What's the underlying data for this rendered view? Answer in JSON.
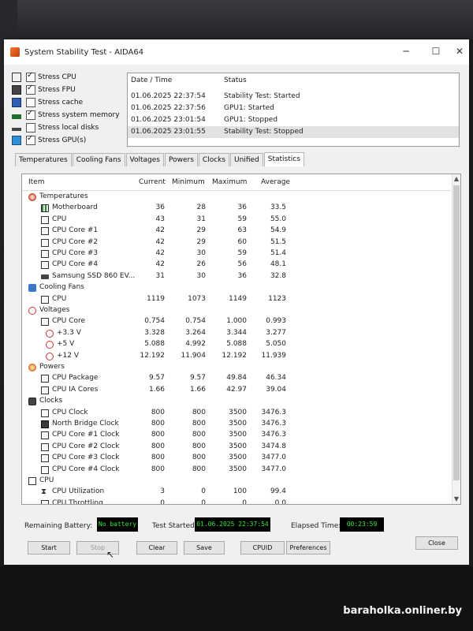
{
  "window": {
    "title": "System Stability Test - AIDA64"
  },
  "stress_options": [
    {
      "label": "Stress CPU",
      "checked": true,
      "icon": "cpu-chip-icon"
    },
    {
      "label": "Stress FPU",
      "checked": true,
      "icon": "fpu-chip-icon"
    },
    {
      "label": "Stress cache",
      "checked": false,
      "icon": "cache-chip-icon"
    },
    {
      "label": "Stress system memory",
      "checked": true,
      "icon": "memory-module-icon"
    },
    {
      "label": "Stress local disks",
      "checked": false,
      "icon": "disk-drive-icon"
    },
    {
      "label": "Stress GPU(s)",
      "checked": true,
      "icon": "monitor-icon"
    }
  ],
  "log": {
    "headers": {
      "datetime": "Date / Time",
      "status": "Status"
    },
    "rows": [
      {
        "datetime": "01.06.2025 22:37:54",
        "status": "Stability Test: Started"
      },
      {
        "datetime": "01.06.2025 22:37:56",
        "status": "GPU1: Started"
      },
      {
        "datetime": "01.06.2025 23:01:54",
        "status": "GPU1: Stopped"
      },
      {
        "datetime": "01.06.2025 23:01:55",
        "status": "Stability Test: Stopped"
      }
    ]
  },
  "tabs": [
    "Temperatures",
    "Cooling Fans",
    "Voltages",
    "Powers",
    "Clocks",
    "Unified",
    "Statistics"
  ],
  "active_tab": "Statistics",
  "stats": {
    "headers": {
      "item": "Item",
      "current": "Current",
      "minimum": "Minimum",
      "maximum": "Maximum",
      "average": "Average"
    },
    "rows": [
      {
        "type": "group",
        "label": "Temperatures",
        "icon": "temp"
      },
      {
        "type": "item",
        "label": "Motherboard",
        "icon": "mb",
        "current": "36",
        "minimum": "28",
        "maximum": "36",
        "average": "33.5"
      },
      {
        "type": "item",
        "label": "CPU",
        "icon": "chip",
        "current": "43",
        "minimum": "31",
        "maximum": "59",
        "average": "55.0"
      },
      {
        "type": "item",
        "label": "CPU Core #1",
        "icon": "chip",
        "current": "42",
        "minimum": "29",
        "maximum": "63",
        "average": "54.9"
      },
      {
        "type": "item",
        "label": "CPU Core #2",
        "icon": "chip",
        "current": "42",
        "minimum": "29",
        "maximum": "60",
        "average": "51.5"
      },
      {
        "type": "item",
        "label": "CPU Core #3",
        "icon": "chip",
        "current": "42",
        "minimum": "30",
        "maximum": "59",
        "average": "51.4"
      },
      {
        "type": "item",
        "label": "CPU Core #4",
        "icon": "chip",
        "current": "42",
        "minimum": "26",
        "maximum": "56",
        "average": "48.1"
      },
      {
        "type": "item",
        "label": "Samsung SSD 860 EV...",
        "icon": "ssd",
        "current": "31",
        "minimum": "30",
        "maximum": "36",
        "average": "32.8"
      },
      {
        "type": "group",
        "label": "Cooling Fans",
        "icon": "fan"
      },
      {
        "type": "item",
        "label": "CPU",
        "icon": "chip",
        "current": "1119",
        "minimum": "1073",
        "maximum": "1149",
        "average": "1123"
      },
      {
        "type": "group",
        "label": "Voltages",
        "icon": "volt"
      },
      {
        "type": "item",
        "label": "CPU Core",
        "icon": "chip",
        "current": "0.754",
        "minimum": "0.754",
        "maximum": "1.000",
        "average": "0.993"
      },
      {
        "type": "item",
        "label": "+3.3 V",
        "icon": "volt",
        "current": "3.328",
        "minimum": "3.264",
        "maximum": "3.344",
        "average": "3.277"
      },
      {
        "type": "item",
        "label": "+5 V",
        "icon": "volt",
        "current": "5.088",
        "minimum": "4.992",
        "maximum": "5.088",
        "average": "5.050"
      },
      {
        "type": "item",
        "label": "+12 V",
        "icon": "volt",
        "current": "12.192",
        "minimum": "11.904",
        "maximum": "12.192",
        "average": "11.939"
      },
      {
        "type": "group",
        "label": "Powers",
        "icon": "power"
      },
      {
        "type": "item",
        "label": "CPU Package",
        "icon": "chip",
        "current": "9.57",
        "minimum": "9.57",
        "maximum": "49.84",
        "average": "46.34"
      },
      {
        "type": "item",
        "label": "CPU IA Cores",
        "icon": "chip",
        "current": "1.66",
        "minimum": "1.66",
        "maximum": "42.97",
        "average": "39.04"
      },
      {
        "type": "group",
        "label": "Clocks",
        "icon": "clock"
      },
      {
        "type": "item",
        "label": "CPU Clock",
        "icon": "chip",
        "current": "800",
        "minimum": "800",
        "maximum": "3500",
        "average": "3476.3"
      },
      {
        "type": "item",
        "label": "North Bridge Clock",
        "icon": "nb",
        "current": "800",
        "minimum": "800",
        "maximum": "3500",
        "average": "3476.3"
      },
      {
        "type": "item",
        "label": "CPU Core #1 Clock",
        "icon": "chip",
        "current": "800",
        "minimum": "800",
        "maximum": "3500",
        "average": "3476.3"
      },
      {
        "type": "item",
        "label": "CPU Core #2 Clock",
        "icon": "chip",
        "current": "800",
        "minimum": "800",
        "maximum": "3500",
        "average": "3474.8"
      },
      {
        "type": "item",
        "label": "CPU Core #3 Clock",
        "icon": "chip",
        "current": "800",
        "minimum": "800",
        "maximum": "3500",
        "average": "3477.0"
      },
      {
        "type": "item",
        "label": "CPU Core #4 Clock",
        "icon": "chip",
        "current": "800",
        "minimum": "800",
        "maximum": "3500",
        "average": "3477.0"
      },
      {
        "type": "group",
        "label": "CPU",
        "icon": "cpu"
      },
      {
        "type": "item",
        "label": "CPU Utilization",
        "icon": "hourglass",
        "current": "3",
        "minimum": "0",
        "maximum": "100",
        "average": "99.4"
      },
      {
        "type": "item",
        "label": "CPU Throttling",
        "icon": "chip",
        "current": "0",
        "minimum": "0",
        "maximum": "0",
        "average": "0.0"
      }
    ]
  },
  "status": {
    "battery_label": "Remaining Battery:",
    "battery_value": "No battery",
    "started_label": "Test Started:",
    "started_value": "01.06.2025 22:37:54",
    "elapsed_label": "Elapsed Time:",
    "elapsed_value": "00:23:59"
  },
  "buttons": {
    "start": "Start",
    "stop": "Stop",
    "clear": "Clear",
    "save": "Save",
    "cpuid": "CPUID",
    "preferences": "Preferences",
    "close": "Close"
  },
  "watermark": "baraholka.onliner.by",
  "colors": {
    "status_box_bg": "#000000",
    "status_box_text": "#33e833"
  }
}
